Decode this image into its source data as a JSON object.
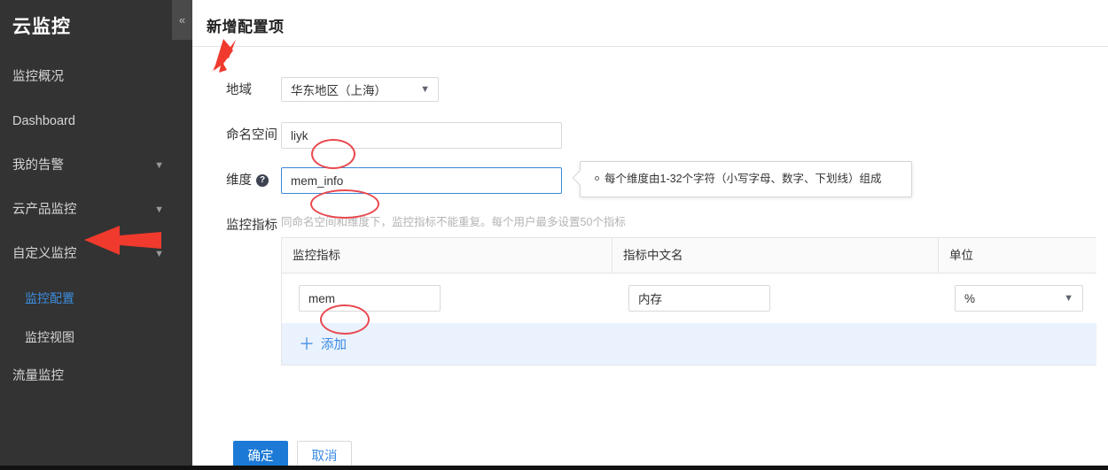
{
  "sidebar": {
    "brand": "云监控",
    "collapse_icon": "double-chevron-left-icon",
    "items": [
      {
        "label": "监控概况",
        "sub": false,
        "active": false,
        "chevron": ""
      },
      {
        "label": "Dashboard",
        "sub": false,
        "active": false,
        "chevron": ""
      },
      {
        "label": "我的告警",
        "sub": false,
        "active": false,
        "chevron": "chevron-down-icon"
      },
      {
        "label": "云产品监控",
        "sub": false,
        "active": false,
        "chevron": "chevron-down-icon"
      },
      {
        "label": "自定义监控",
        "sub": false,
        "active": false,
        "chevron": "chevron-down-icon"
      },
      {
        "label": "监控配置",
        "sub": true,
        "active": true,
        "chevron": ""
      },
      {
        "label": "监控视图",
        "sub": true,
        "active": false,
        "chevron": ""
      },
      {
        "label": "流量监控",
        "sub": false,
        "active": false,
        "chevron": ""
      }
    ],
    "bg_color": "#333333",
    "active_color": "#3d8ee0"
  },
  "page": {
    "title": "新增配置项"
  },
  "form": {
    "region": {
      "label": "地域",
      "value": "华东地区（上海）",
      "caret_icon": "chevron-down-icon"
    },
    "namespace": {
      "label": "命名空间",
      "value": "liyk",
      "placeholder": ""
    },
    "dimension": {
      "label": "维度",
      "help_icon": "question-mark-icon",
      "help_glyph": "?",
      "value": "mem_info",
      "placeholder": "",
      "focused": true,
      "tooltip": "每个维度由1-32个字符（小写字母、数字、下划线）组成"
    },
    "metrics": {
      "label": "监控指标",
      "hint": "同命名空间和维度下，监控指标不能重复。每个用户最多设置50个指标",
      "columns": [
        "监控指标",
        "指标中文名",
        "单位"
      ],
      "rows": [
        {
          "metric": "mem",
          "metric_cn": "内存",
          "unit": "%",
          "unit_caret_icon": "chevron-down-icon"
        }
      ],
      "add": {
        "plus_icon": "plus-icon",
        "plus_glyph": "＋",
        "label": "添加"
      }
    }
  },
  "footer": {
    "confirm_label": "确定",
    "cancel_label": "取消",
    "primary_color": "#1c7ad6"
  },
  "annotations": {
    "arrow_color": "#ef3a2d",
    "ellipse_color": "#e8494f",
    "arrow_title_name": "arrow-pointing-to-title",
    "arrow_sidebar_name": "arrow-pointing-to-monitor-config",
    "ellipse_namespace_name": "highlight-ellipse-namespace",
    "ellipse_dimension_name": "highlight-ellipse-dimension",
    "ellipse_metric_name": "highlight-ellipse-metric"
  }
}
